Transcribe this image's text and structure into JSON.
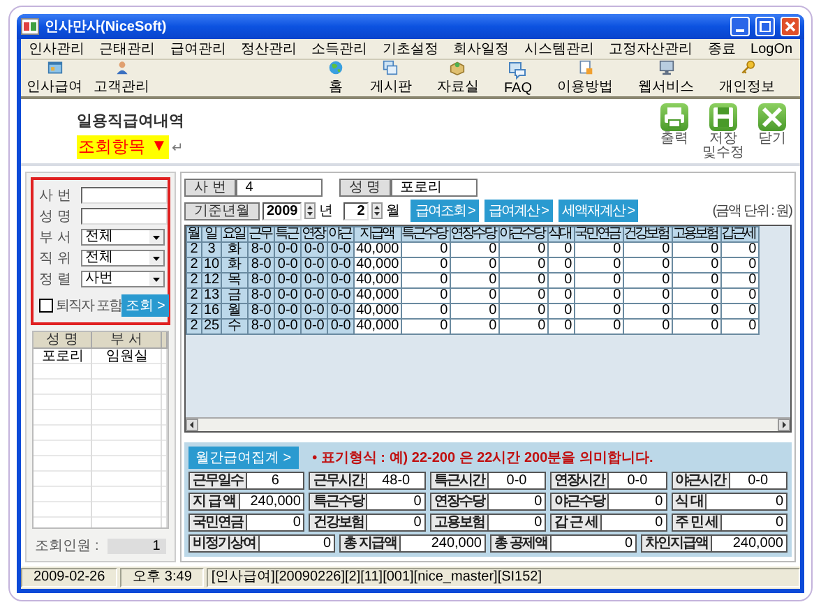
{
  "window": {
    "title": "인사만사(NiceSoft)"
  },
  "menu": [
    "인사관리",
    "근태관리",
    "급여관리",
    "정산관리",
    "소득관리",
    "기초설정",
    "회사일정",
    "시스템관리",
    "고정자산관리",
    "종료",
    "LogOn"
  ],
  "toolbar": {
    "left": [
      "인사급여",
      "고객관리"
    ],
    "right": [
      "홈",
      "게시판",
      "자료실",
      "FAQ",
      "이용방법",
      "웹서비스",
      "개인정보"
    ]
  },
  "page": {
    "title": "일용직급여내역",
    "section": "조회항목",
    "section_arrow": "▼",
    "return_mark": "↵"
  },
  "actions": [
    "출력",
    "저장 및수정",
    "닫기"
  ],
  "search": {
    "fields": [
      {
        "kind": "input",
        "label": "사 번"
      },
      {
        "kind": "input",
        "label": "성 명"
      },
      {
        "kind": "select",
        "label": "부 서",
        "value": "전체"
      },
      {
        "kind": "select",
        "label": "직 위",
        "value": "전체"
      },
      {
        "kind": "select",
        "label": "정 렬",
        "value": "사번"
      }
    ],
    "retired": {
      "label": "퇴직자 포함",
      "checked": false
    },
    "button": "조회 >"
  },
  "employees": {
    "columns": [
      "성 명",
      "부 서"
    ],
    "rows": [
      [
        "포로리",
        "임원실"
      ]
    ],
    "count_label": "조회인원 :",
    "count": "1"
  },
  "employee": [
    {
      "label": "사 번",
      "value": "4"
    },
    {
      "label": "성 명",
      "value": "포로리"
    }
  ],
  "period": {
    "label": "기준년월",
    "year": "2009",
    "year_unit": "년",
    "month": "2",
    "month_unit": "월",
    "buttons": [
      "급여조회 >",
      "급여계산 >",
      "세액재계산 >"
    ],
    "unit_note": "(금액 단위 : 원)"
  },
  "table": {
    "columns": [
      "월",
      "일",
      "요일",
      "근무",
      "특근",
      "연장",
      "야근",
      "지급액",
      "특근수당",
      "연장수당",
      "야근수당",
      "식대",
      "국민연금",
      "건강보험",
      "고용보험",
      "갑근세"
    ],
    "rows": [
      [
        "2",
        "3",
        "화",
        "8-0",
        "0-0",
        "0-0",
        "0-0",
        "40,000",
        "0",
        "0",
        "0",
        "0",
        "0",
        "0",
        "0",
        "0"
      ],
      [
        "2",
        "10",
        "화",
        "8-0",
        "0-0",
        "0-0",
        "0-0",
        "40,000",
        "0",
        "0",
        "0",
        "0",
        "0",
        "0",
        "0",
        "0"
      ],
      [
        "2",
        "12",
        "목",
        "8-0",
        "0-0",
        "0-0",
        "0-0",
        "40,000",
        "0",
        "0",
        "0",
        "0",
        "0",
        "0",
        "0",
        "0"
      ],
      [
        "2",
        "13",
        "금",
        "8-0",
        "0-0",
        "0-0",
        "0-0",
        "40,000",
        "0",
        "0",
        "0",
        "0",
        "0",
        "0",
        "0",
        "0"
      ],
      [
        "2",
        "16",
        "월",
        "8-0",
        "0-0",
        "0-0",
        "0-0",
        "40,000",
        "0",
        "0",
        "0",
        "0",
        "0",
        "0",
        "0",
        "0"
      ],
      [
        "2",
        "25",
        "수",
        "8-0",
        "0-0",
        "0-0",
        "0-0",
        "40,000",
        "0",
        "0",
        "0",
        "0",
        "0",
        "0",
        "0",
        "0"
      ]
    ]
  },
  "summary": {
    "button": "월간급여집계 >",
    "note": "• 표기형식 : 예) 22-200 은 22시간 200분을 의미합니다.",
    "rows": [
      [
        {
          "label": "근무일수",
          "value": "6"
        },
        {
          "label": "근무시간",
          "value": "48-0"
        },
        {
          "label": "특근시간",
          "value": "0-0"
        },
        {
          "label": "연장시간",
          "value": "0-0"
        },
        {
          "label": "야근시간",
          "value": "0-0"
        }
      ],
      [
        {
          "label": "지 급 액",
          "value": "240,000"
        },
        {
          "label": "특근수당",
          "value": "0"
        },
        {
          "label": "연장수당",
          "value": "0"
        },
        {
          "label": "야근수당",
          "value": "0"
        },
        {
          "label": "식 대",
          "value": "0"
        }
      ],
      [
        {
          "label": "국민연금",
          "value": "0"
        },
        {
          "label": "건강보험",
          "value": "0"
        },
        {
          "label": "고용보험",
          "value": "0"
        },
        {
          "label": "갑 근 세",
          "value": "0"
        },
        {
          "label": "주 민 세",
          "value": "0"
        }
      ],
      [
        {
          "label": "비정기상여",
          "value": "0"
        },
        {
          "label": "총 지급액",
          "value": "240,000"
        },
        {
          "label": "총 공제액",
          "value": "0"
        },
        {
          "label": "차인지급액",
          "value": "240,000"
        }
      ]
    ]
  },
  "status_bar": [
    "2009-02-26",
    "오후 3:49",
    "[인사급여][20090226][2][11][001][nice_master][SI152]"
  ]
}
